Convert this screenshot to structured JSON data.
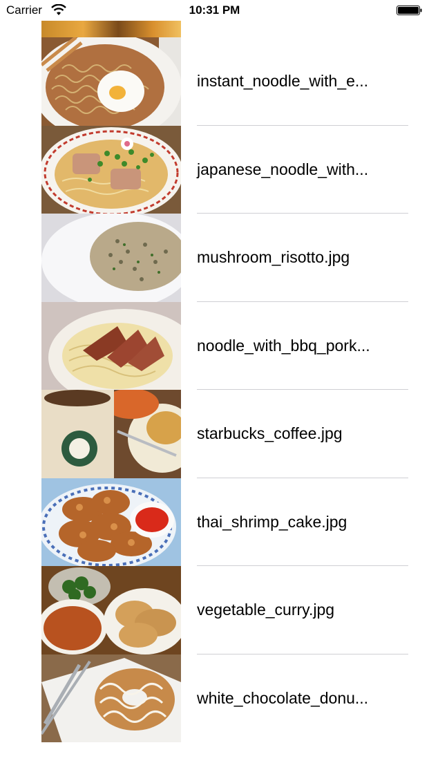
{
  "status_bar": {
    "carrier": "Carrier",
    "time": "10:31 PM",
    "wifi_icon": "wifi-icon",
    "battery_icon": "battery-icon"
  },
  "photos": [
    {
      "name": "instant_noodle_with_e...",
      "thumbnail": "instant-noodle-thumbnail"
    },
    {
      "name": "japanese_noodle_with...",
      "thumbnail": "japanese-noodle-thumbnail"
    },
    {
      "name": "mushroom_risotto.jpg",
      "thumbnail": "mushroom-risotto-thumbnail"
    },
    {
      "name": "noodle_with_bbq_pork...",
      "thumbnail": "bbq-pork-noodle-thumbnail"
    },
    {
      "name": "starbucks_coffee.jpg",
      "thumbnail": "starbucks-coffee-thumbnail"
    },
    {
      "name": "thai_shrimp_cake.jpg",
      "thumbnail": "thai-shrimp-cake-thumbnail"
    },
    {
      "name": "vegetable_curry.jpg",
      "thumbnail": "vegetable-curry-thumbnail"
    },
    {
      "name": "white_chocolate_donu...",
      "thumbnail": "white-chocolate-donut-thumbnail"
    }
  ]
}
